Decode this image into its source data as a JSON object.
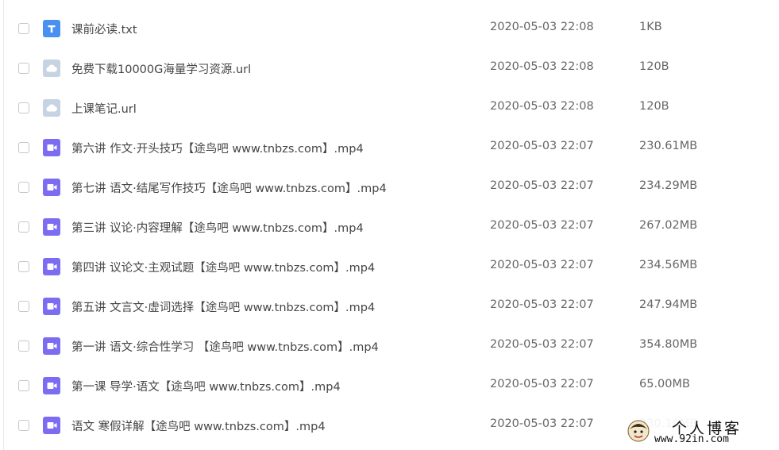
{
  "files": [
    {
      "type": "txt",
      "icon": "text-file-icon",
      "name": "课前必读.txt",
      "date": "2020-05-03 22:08",
      "size": "1KB"
    },
    {
      "type": "url",
      "icon": "cloud-link-icon",
      "name": "免费下载10000G海量学习资源.url",
      "date": "2020-05-03 22:08",
      "size": "120B"
    },
    {
      "type": "url",
      "icon": "cloud-link-icon",
      "name": "上课笔记.url",
      "date": "2020-05-03 22:08",
      "size": "120B"
    },
    {
      "type": "mp4",
      "icon": "video-file-icon",
      "name": "第六讲 作文·开头技巧【途鸟吧 www.tnbzs.com】.mp4",
      "date": "2020-05-03 22:07",
      "size": "230.61MB"
    },
    {
      "type": "mp4",
      "icon": "video-file-icon",
      "name": "第七讲 语文·结尾写作技巧【途鸟吧 www.tnbzs.com】.mp4",
      "date": "2020-05-03 22:07",
      "size": "234.29MB"
    },
    {
      "type": "mp4",
      "icon": "video-file-icon",
      "name": "第三讲 议论·内容理解【途鸟吧 www.tnbzs.com】.mp4",
      "date": "2020-05-03 22:07",
      "size": "267.02MB"
    },
    {
      "type": "mp4",
      "icon": "video-file-icon",
      "name": "第四讲 议论文·主观试题【途鸟吧 www.tnbzs.com】.mp4",
      "date": "2020-05-03 22:07",
      "size": "234.56MB"
    },
    {
      "type": "mp4",
      "icon": "video-file-icon",
      "name": "第五讲 文言文·虚词选择【途鸟吧 www.tnbzs.com】.mp4",
      "date": "2020-05-03 22:07",
      "size": "247.94MB"
    },
    {
      "type": "mp4",
      "icon": "video-file-icon",
      "name": "第一讲 语文·综合性学习 【途鸟吧 www.tnbzs.com】.mp4",
      "date": "2020-05-03 22:07",
      "size": "354.80MB"
    },
    {
      "type": "mp4",
      "icon": "video-file-icon",
      "name": "第一课 导学·语文【途鸟吧 www.tnbzs.com】.mp4",
      "date": "2020-05-03 22:07",
      "size": "65.00MB"
    },
    {
      "type": "mp4",
      "icon": "video-file-icon",
      "name": "语文 寒假详解【途鸟吧 www.tnbzs.com】.mp4",
      "date": "2020-05-03 22:07",
      "size": "230.16MB"
    }
  ],
  "watermark": {
    "title": "个人博客",
    "url": "www.92in.com"
  },
  "colors": {
    "txt_icon": "#4a90f0",
    "url_icon": "#c5d3e2",
    "video_icon": "#7b6cf2"
  }
}
